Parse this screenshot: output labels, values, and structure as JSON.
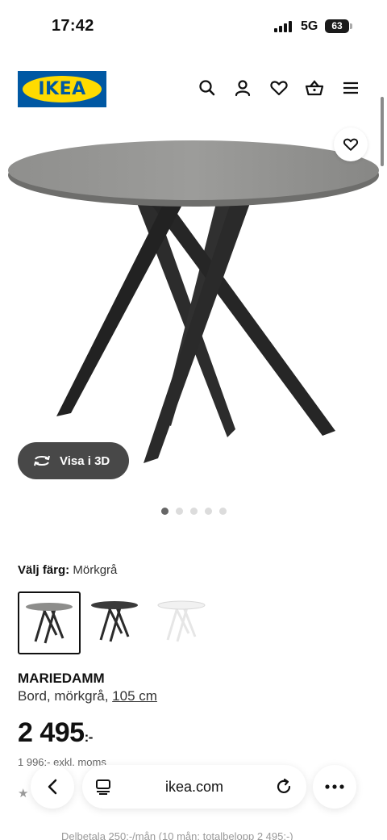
{
  "status_bar": {
    "time": "17:42",
    "network": "5G",
    "battery": "63"
  },
  "header": {
    "logo_text": "IKEA",
    "icons": [
      "search-icon",
      "account-icon",
      "heart-icon",
      "basket-icon",
      "menu-icon"
    ]
  },
  "gallery": {
    "view_3d_label": "Visa i 3D",
    "image_count": 5,
    "active_index": 0
  },
  "color_picker": {
    "label": "Välj färg:",
    "selected": "Mörkgrå",
    "options": [
      {
        "name": "Mörkgrå",
        "top": "#8d8d8b",
        "legs": "#2b2b2b"
      },
      {
        "name": "Svart",
        "top": "#3a3a3a",
        "legs": "#2b2b2b"
      },
      {
        "name": "Vit",
        "top": "#f1f1f1",
        "legs": "#e6e6e6"
      }
    ]
  },
  "product": {
    "name": "MARIEDAMM",
    "description": "Bord, mörkgrå,",
    "size_link": "105 cm",
    "price": "2 495",
    "price_suffix": ":-",
    "price_ex_vat": "1 996:- exkl. moms",
    "installment": "Delbetala 250:-/mån (10 mån: totalbelopp 2 495:-)"
  },
  "browser": {
    "url": "ikea.com"
  },
  "colors": {
    "ikea_blue": "#0058a3",
    "ikea_yellow": "#ffdb00",
    "table_top": "#8d8d8b",
    "table_legs": "#2b2b2b"
  }
}
